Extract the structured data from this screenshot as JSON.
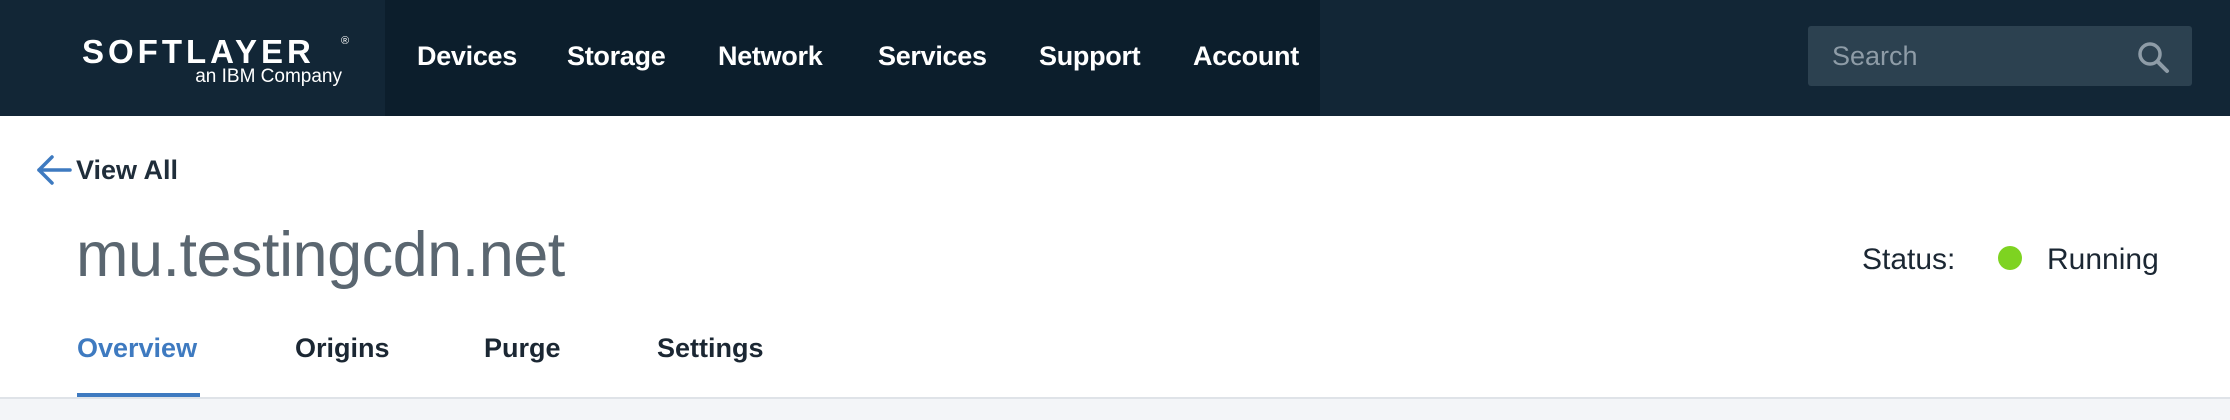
{
  "header": {
    "logo": {
      "wordmark": "SOFTLAYER",
      "registered": "®",
      "tagline": "an IBM Company"
    },
    "nav": [
      {
        "label": "Devices"
      },
      {
        "label": "Storage"
      },
      {
        "label": "Network"
      },
      {
        "label": "Services"
      },
      {
        "label": "Support"
      },
      {
        "label": "Account"
      }
    ],
    "search": {
      "placeholder": "Search",
      "value": "",
      "icon": "search-icon"
    }
  },
  "back_link": {
    "label": "View All",
    "icon": "arrow-left-icon"
  },
  "page": {
    "title": "mu.testingcdn.net"
  },
  "status": {
    "label": "Status:",
    "value": "Running",
    "color": "#7ed321"
  },
  "tabs": [
    {
      "label": "Overview",
      "active": true
    },
    {
      "label": "Origins",
      "active": false
    },
    {
      "label": "Purge",
      "active": false
    },
    {
      "label": "Settings",
      "active": false
    }
  ],
  "colors": {
    "header_bg": "#122636",
    "nav_bg": "#0c1e2c",
    "accent": "#3e7ac0",
    "status_running": "#7ed321"
  }
}
